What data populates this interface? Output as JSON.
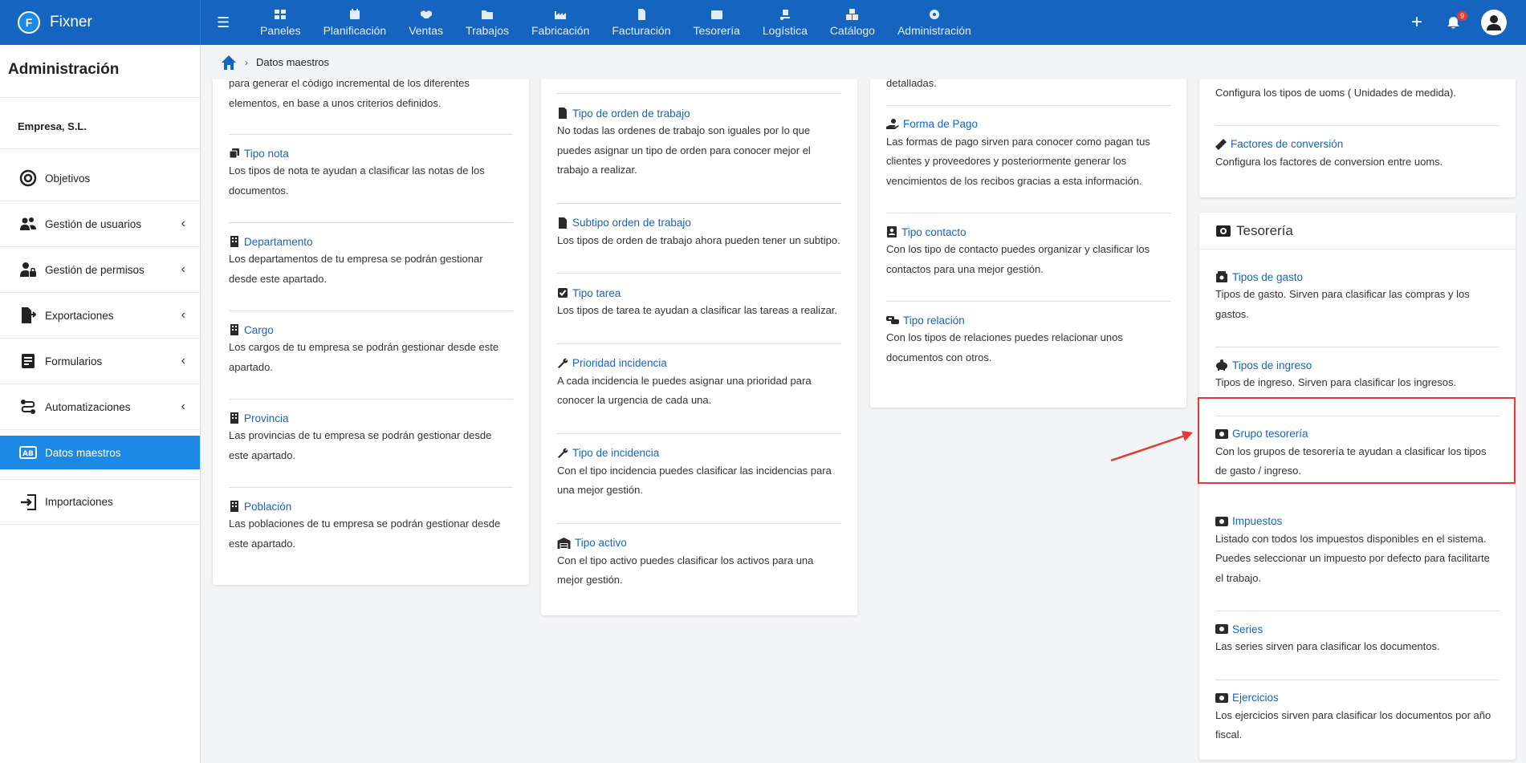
{
  "app": {
    "name": "Fixner",
    "logo_letter": "F"
  },
  "topnav": {
    "items": [
      {
        "label": "Paneles",
        "icon": "grid-icon"
      },
      {
        "label": "Planificación",
        "icon": "calendar-icon"
      },
      {
        "label": "Ventas",
        "icon": "handshake-icon"
      },
      {
        "label": "Trabajos",
        "icon": "folder-icon"
      },
      {
        "label": "Fabricación",
        "icon": "factory-icon"
      },
      {
        "label": "Facturación",
        "icon": "invoice-icon"
      },
      {
        "label": "Tesorería",
        "icon": "money-icon"
      },
      {
        "label": "Logística",
        "icon": "dolly-icon"
      },
      {
        "label": "Catálogo",
        "icon": "boxes-icon"
      },
      {
        "label": "Administración",
        "icon": "gear-icon"
      }
    ],
    "plus": "+",
    "notifications_count": "9"
  },
  "sidebar": {
    "title": "Administración",
    "company": "Empresa, S.L.",
    "items": [
      {
        "label": "Objetivos",
        "chevron": ""
      },
      {
        "label": "Gestión de usuarios",
        "chevron": "‹"
      },
      {
        "label": "Gestión de permisos",
        "chevron": "‹"
      },
      {
        "label": "Exportaciones",
        "chevron": "‹"
      },
      {
        "label": "Formularios",
        "chevron": "‹"
      },
      {
        "label": "Automatizaciones",
        "chevron": "‹"
      },
      {
        "label": "Datos maestros",
        "chevron": ""
      },
      {
        "label": "Importaciones",
        "chevron": ""
      }
    ]
  },
  "breadcrumb": {
    "current": "Datos maestros"
  },
  "col1": {
    "partial": "para generar el código incremental de los diferentes elementos, en base a unos criterios definidos.",
    "entries": [
      {
        "title": "Tipo nota",
        "desc": "Los tipos de nota te ayudan a clasificar las notas de los documentos."
      },
      {
        "title": "Departamento",
        "desc": "Los departamentos de tu empresa se podrán gestionar desde este apartado."
      },
      {
        "title": "Cargo",
        "desc": "Los cargos de tu empresa se podrán gestionar desde este apartado."
      },
      {
        "title": "Provincia",
        "desc": "Las provincias de tu empresa se podrán gestionar desde este apartado."
      },
      {
        "title": "Población",
        "desc": "Las poblaciones de tu empresa se podrán gestionar desde este apartado."
      }
    ]
  },
  "col2": {
    "entries": [
      {
        "title": "Tipo de orden de trabajo",
        "desc": "No todas las ordenes de trabajo son iguales por lo que puedes asignar un tipo de orden para conocer mejor el trabajo a realizar."
      },
      {
        "title": "Subtipo orden de trabajo",
        "desc": "Los tipos de orden de trabajo ahora pueden tener un subtipo."
      },
      {
        "title": "Tipo tarea",
        "desc": "Los tipos de tarea te ayudan a clasificar las tareas a realizar."
      },
      {
        "title": "Prioridad incidencia",
        "desc": "A cada incidencia le puedes asignar una prioridad para conocer la urgencia de cada una."
      },
      {
        "title": "Tipo de incidencia",
        "desc": "Con el tipo incidencia puedes clasificar las incidencias para una mejor gestión."
      },
      {
        "title": "Tipo activo",
        "desc": "Con el tipo activo puedes clasificar los activos para una mejor gestión."
      }
    ]
  },
  "col3": {
    "partial": "detalladas.",
    "entries": [
      {
        "title": "Forma de Pago",
        "desc": "Las formas de pago sirven para conocer como pagan tus clientes y proveedores y posteriormente generar los vencimientos de los recibos gracias a esta información."
      },
      {
        "title": "Tipo contacto",
        "desc": "Con los tipo de contacto puedes organizar y clasificar los contactos para una mejor gestión."
      },
      {
        "title": "Tipo relación",
        "desc": "Con los tipos de relaciones puedes relacionar unos documentos con otros."
      }
    ]
  },
  "col4": {
    "partial": "Configura los tipos de uoms ( Unidades de medida).",
    "entries": [
      {
        "title": "Factores de conversión",
        "desc": "Configura los factores de conversion entre uoms."
      }
    ],
    "tesoreria": {
      "header": "Tesorería",
      "entries": [
        {
          "title": "Tipos de gasto",
          "desc": "Tipos de gasto. Sirven para clasificar las compras y los gastos."
        },
        {
          "title": "Tipos de ingreso",
          "desc": "Tipos de ingreso. Sirven para clasificar los ingresos."
        },
        {
          "title": "Grupo tesorería",
          "desc": "Con los grupos de tesorería te ayudan a clasificar los tipos de gasto / ingreso."
        },
        {
          "title": "Impuestos",
          "desc": "Listado con todos los impuestos disponibles en el sistema. Puedes seleccionar un impuesto por defecto para facilitarte el trabajo."
        },
        {
          "title": "Series",
          "desc": "Las series sirven para clasificar los documentos."
        },
        {
          "title": "Ejercicios",
          "desc": "Los ejercicios sirven para clasificar los documentos por año fiscal."
        }
      ]
    }
  },
  "colors": {
    "primary": "#1565c0",
    "active": "#1e88e5",
    "highlight": "#e53935"
  }
}
